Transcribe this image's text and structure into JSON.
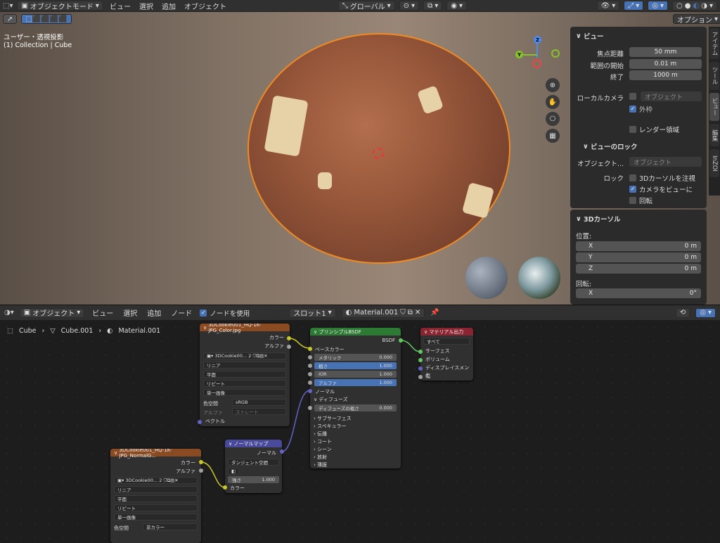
{
  "header3d": {
    "mode": "オブジェクトモード",
    "menus": [
      "ビュー",
      "選択",
      "追加",
      "オブジェクト"
    ],
    "orientation": "グローバル",
    "options_label": "オプション"
  },
  "viewport": {
    "view_name": "ユーザー・透視投影",
    "collection": "(1) Collection | Cube",
    "gizmo_labels": {
      "z": "Z",
      "y": "Y"
    }
  },
  "npanel": {
    "view_title": "ビュー",
    "focal_label": "焦点距離",
    "focal_value": "50 mm",
    "clip_start_label": "範囲の開始",
    "clip_start_value": "0.01 m",
    "clip_end_label": "終了",
    "clip_end_value": "1000 m",
    "local_camera_label": "ローカルカメラ",
    "local_camera_placeholder": "オブジェクト",
    "outline_label": "外枠",
    "render_region_label": "レンダー領域",
    "lock_title": "ビューのロック",
    "lock_object_label": "オブジェクト...",
    "lock_object_placeholder": "オブジェクト",
    "lock_label": "ロック",
    "lock_cursor": "3Dカーソルを注視",
    "lock_camera": "カメラをビューに",
    "lock_rotation": "回転",
    "cursor_title": "3Dカーソル",
    "location_label": "位置:",
    "x_label": "X",
    "x_value": "0 m",
    "y_label": "Y",
    "y_value": "0 m",
    "z_label": "Z",
    "z_value": "0 m",
    "rotation_label": "回転:",
    "rx_label": "X",
    "rx_value": "0°"
  },
  "side_tabs": [
    "アイテム",
    "ツール",
    "ビュー",
    "編集",
    "InZOI"
  ],
  "node_header": {
    "object_label": "オブジェクト",
    "menus": [
      "ビュー",
      "選択",
      "追加",
      "ノード"
    ],
    "use_nodes": "ノードを使用",
    "slot": "スロット1",
    "material": "Material.001"
  },
  "breadcrumb": {
    "object": "Cube",
    "mesh": "Cube.001",
    "material": "Material.001"
  },
  "nodes": {
    "img1": {
      "title": "3DCookie001_HQ-1K-JPG_Color.jpg",
      "out_color": "カラー",
      "out_alpha": "アルファ",
      "image_name": "3DCookie00...",
      "users": "2",
      "interp": "リニア",
      "proj": "平面",
      "ext": "リピート",
      "source": "単一画像",
      "colorspace_label": "色空間",
      "colorspace": "sRGB",
      "alpha_label": "アルファ",
      "alpha": "ストレート",
      "vector": "ベクトル"
    },
    "bsdf": {
      "title": "プリンシプルBSDF",
      "out": "BSDF",
      "base_color": "ベースカラー",
      "metallic": "メタリック",
      "metallic_v": "0.000",
      "roughness": "粗さ",
      "roughness_v": "1.000",
      "ior": "IOR",
      "ior_v": "1.000",
      "alpha": "アルファ",
      "alpha_v": "1.000",
      "normal": "ノーマル",
      "diffuse": "ディフューズ",
      "diffuse_rough": "ディフューズの粗さ",
      "diffuse_rough_v": "0.000",
      "sections": [
        "サブサーフェス",
        "スペキュラー",
        "伝播",
        "コート",
        "シーン",
        "放射",
        "薄膜"
      ]
    },
    "output": {
      "title": "マテリアル出力",
      "target": "すべて",
      "surface": "サーフェス",
      "volume": "ボリューム",
      "displacement": "ディスプレイスメント",
      "thickness": "幅"
    },
    "normalmap": {
      "title": "ノーマルマップ",
      "out": "ノーマル",
      "space": "タンジェント空間",
      "strength": "強さ",
      "strength_v": "1.000",
      "color": "カラー"
    },
    "img2": {
      "title": "3DCookie001_HQ-1K-JPG_NormalG...",
      "out_color": "カラー",
      "out_alpha": "アルファ",
      "image_name": "3DCookie00...",
      "users": "2",
      "interp": "リニア",
      "proj": "平面",
      "ext": "リピート",
      "source": "単一画像",
      "colorspace_label": "色空間",
      "colorspace": "非カラー"
    }
  },
  "colors": {
    "accent": "#4772b3",
    "selection": "#f08a24",
    "image_node": "#8a4b23",
    "shader_node": "#2c7a33",
    "output_node": "#8a2431",
    "vector_node": "#4a4a9c"
  }
}
